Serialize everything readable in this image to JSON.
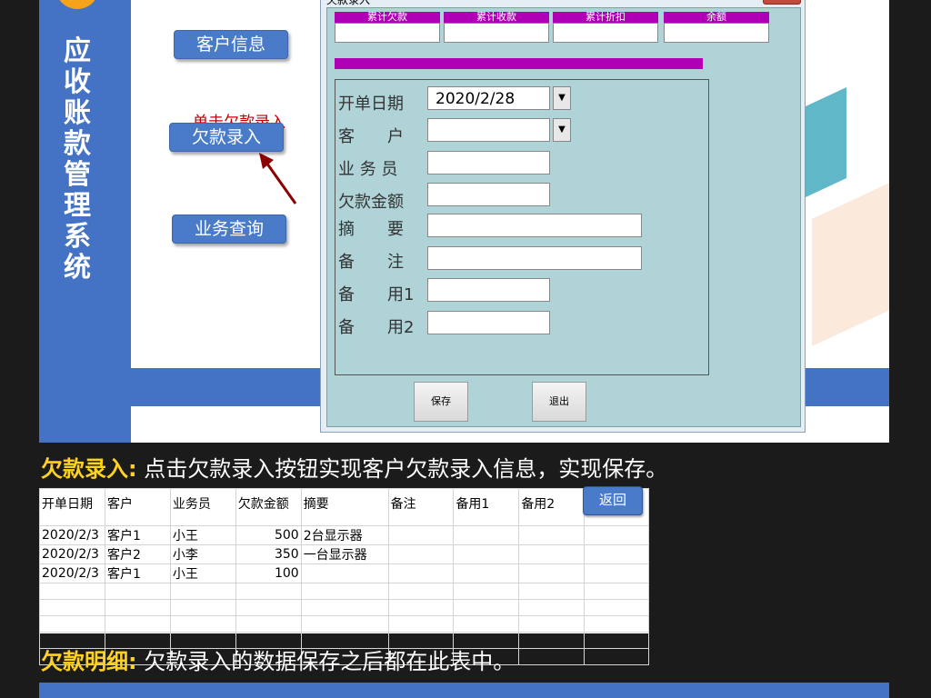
{
  "app": {
    "system_title": "应收账款管理系统",
    "nav": {
      "customer_info": "客户信息",
      "debt_entry": "欠款录入",
      "business_query": "业务查询"
    },
    "hint": "单击欠款录入"
  },
  "dialog": {
    "title": "欠款录入",
    "summary": [
      {
        "label": "累计欠款",
        "value": ""
      },
      {
        "label": "累计收款",
        "value": ""
      },
      {
        "label": "累计折扣",
        "value": ""
      },
      {
        "label": "余额",
        "value": ""
      }
    ],
    "fields": {
      "date_label": "开单日期",
      "date_value": "2020/2/28",
      "customer_label": "客　　户",
      "salesman_label": "业 务 员",
      "amount_label": "欠款金额",
      "summary_label": "摘　　要",
      "remark_label": "备　　注",
      "spare1_label": "备　　用1",
      "spare2_label": "备　　用2"
    },
    "save_label": "保存",
    "exit_label": "退出"
  },
  "caption1": {
    "lead": "欠款录入:",
    "text": "点击欠款录入按钮实现客户欠款录入信息，实现保存。"
  },
  "sheet": {
    "back_label": "返回",
    "columns": [
      "开单日期",
      "客户",
      "业务员",
      "欠款金额",
      "摘要",
      "备注",
      "备用1",
      "备用2"
    ],
    "rows": [
      [
        "2020/2/3",
        "客户1",
        "小王",
        "500",
        "2台显示器",
        "",
        "",
        ""
      ],
      [
        "2020/2/3",
        "客户2",
        "小李",
        "350",
        "一台显示器",
        "",
        "",
        ""
      ],
      [
        "2020/2/3",
        "客户1",
        "小王",
        "100",
        "",
        "",
        "",
        ""
      ]
    ]
  },
  "caption2": {
    "lead": "欠款明细:",
    "text": "欠款录入的数据保存之后都在此表中。"
  },
  "colors": {
    "brand_blue": "#4472c4",
    "magenta": "#b000b5",
    "dialog_teal": "#afd3d6",
    "caption_yellow": "#ffd21f"
  }
}
